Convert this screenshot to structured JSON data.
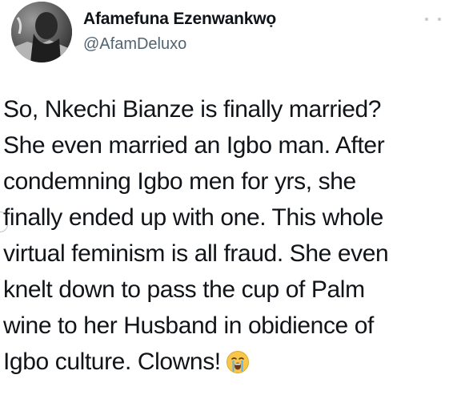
{
  "author": {
    "display_name": "Afamefuna Ezenwankwọ",
    "handle": "@AfamDeluxo"
  },
  "tweet": {
    "text": "So, Nkechi Bianze is finally married?\nShe even married an Igbo man. After\ncondemning Igbo men for yrs, she\nfinally ended up with one. This whole\nvirtual feminism is all fraud. She even\nknelt down to pass the cup of Palm\nwine to her Husband in obidience of\nIgbo culture. Clowns!",
    "emoji": "loudly-crying-face-icon"
  },
  "icons": {
    "more": "more-horizontal-icon",
    "avatar": "user-avatar"
  },
  "colors": {
    "name": "#0f1419",
    "handle": "#536471",
    "text": "#111418",
    "background": "#ffffff"
  }
}
